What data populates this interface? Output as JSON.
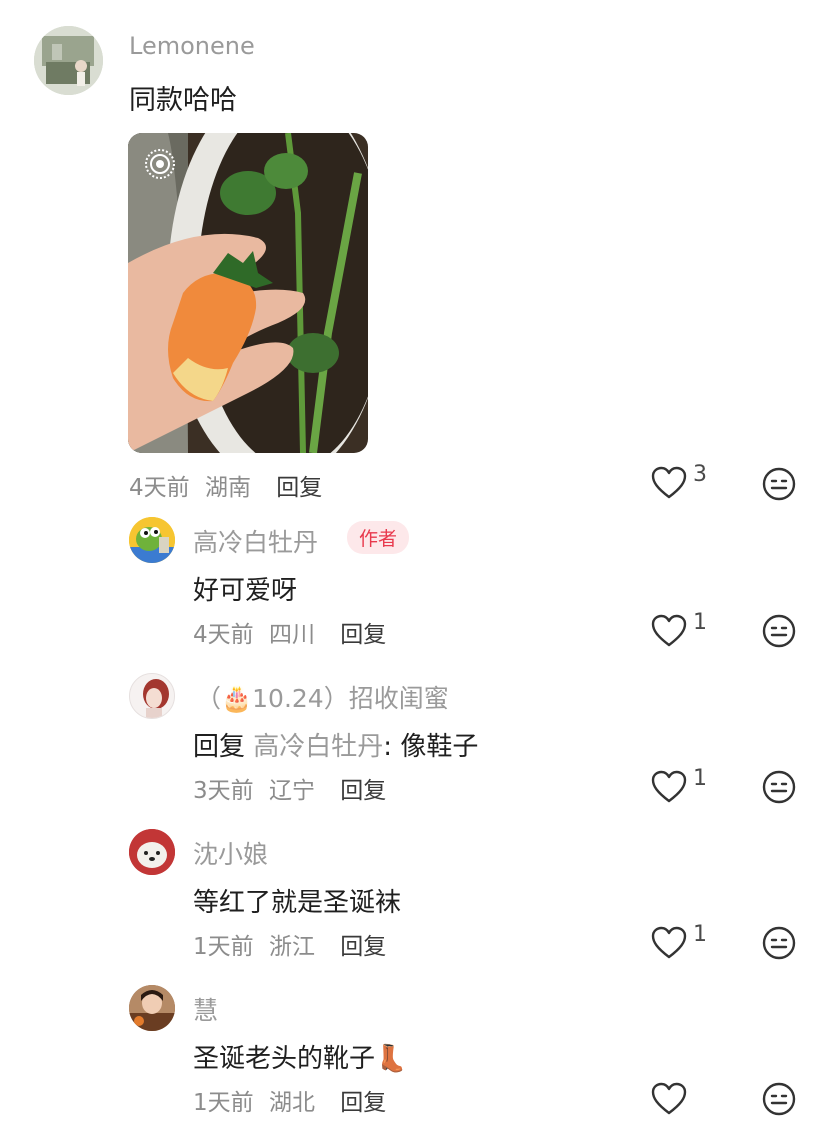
{
  "comments": [
    {
      "username": "Lemonene",
      "text": "同款哈哈",
      "time": "4天前",
      "location": "湖南",
      "reply_label": "回复",
      "likes": "3",
      "image": "strawberry-photo",
      "live_icon": "live-photo-icon"
    },
    {
      "username": "高冷白牡丹",
      "badge": "作者",
      "text": "好可爱呀",
      "time": "4天前",
      "location": "四川",
      "reply_label": "回复",
      "likes": "1"
    },
    {
      "username": "（🎂10.24）招收闺蜜",
      "reply_prefix": "回复",
      "reply_target": "高冷白牡丹",
      "text": ": 像鞋子",
      "time": "3天前",
      "location": "辽宁",
      "reply_label": "回复",
      "likes": "1"
    },
    {
      "username": "沈小娘",
      "text": "等红了就是圣诞袜",
      "time": "1天前",
      "location": "浙江",
      "reply_label": "回复",
      "likes": "1"
    },
    {
      "username": "慧",
      "text": "圣诞老头的靴子👢",
      "time": "1天前",
      "location": "湖北",
      "reply_label": "回复",
      "likes": ""
    }
  ],
  "colors": {
    "like_stroke": "#333333",
    "badge_bg": "#fde8ea",
    "badge_text": "#e8394d",
    "name": "#9a9a9a"
  },
  "icons": [
    "heart-icon",
    "emoji-face-icon",
    "live-photo-icon"
  ]
}
